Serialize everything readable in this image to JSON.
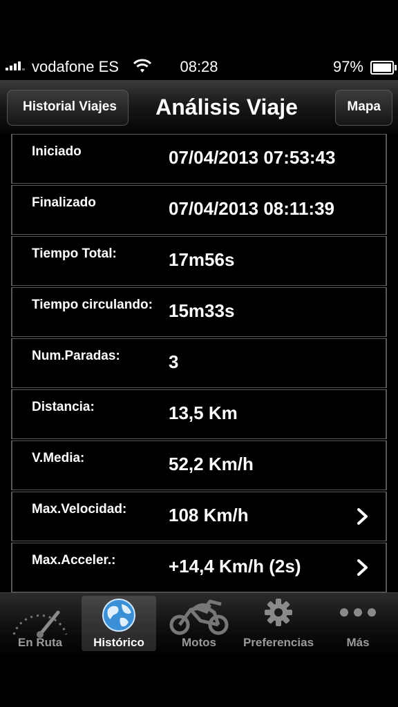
{
  "status_bar": {
    "carrier": "vodafone ES",
    "time": "08:28",
    "battery": "97%"
  },
  "nav": {
    "back_label": "Historial Viajes",
    "title": "Análisis Viaje",
    "right_label": "Mapa"
  },
  "rows": [
    {
      "label": "Iniciado",
      "value": "07/04/2013 07:53:43"
    },
    {
      "label": "Finalizado",
      "value": "07/04/2013 08:11:39"
    },
    {
      "label": "Tiempo Total:",
      "value": "17m56s"
    },
    {
      "label": "Tiempo circulando:",
      "value": "15m33s"
    },
    {
      "label": "Num.Paradas:",
      "value": "3"
    },
    {
      "label": "Distancia:",
      "value": "13,5 Km"
    },
    {
      "label": "V.Media:",
      "value": "52,2 Km/h"
    },
    {
      "label": "Max.Velocidad:",
      "value": "108 Km/h"
    },
    {
      "label": "Max.Acceler.:",
      "value": "+14,4 Km/h (2s)"
    }
  ],
  "tabs": [
    {
      "label": "En Ruta",
      "icon": "speedometer-icon"
    },
    {
      "label": "Histórico",
      "icon": "globe-icon",
      "active": true
    },
    {
      "label": "Motos",
      "icon": "motorcycle-icon"
    },
    {
      "label": "Preferencias",
      "icon": "gear-icon"
    },
    {
      "label": "Más",
      "icon": "more-icon"
    }
  ]
}
